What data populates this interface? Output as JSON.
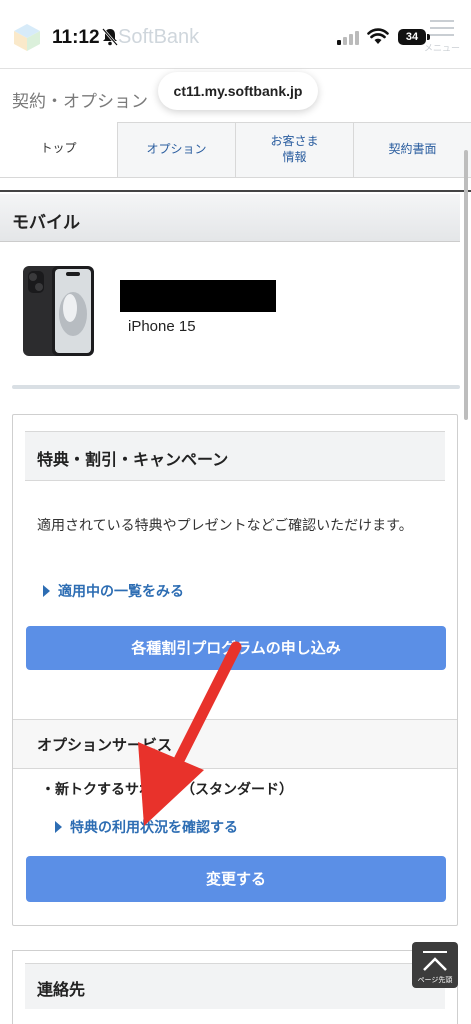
{
  "status_bar": {
    "time": "11:12",
    "battery": "34",
    "brand_ghost": "SoftBank",
    "menu_ghost": "メニュー"
  },
  "header": {
    "title": "契約・オプション",
    "url": "ct11.my.softbank.jp"
  },
  "tabs": [
    {
      "label": "トップ"
    },
    {
      "label": "オプション"
    },
    {
      "label": "お客さま\n情報"
    },
    {
      "label": "契約書面"
    }
  ],
  "mobile": {
    "section_title": "モバイル",
    "device_name": "iPhone 15"
  },
  "benefits": {
    "title": "特典・割引・キャンペーン",
    "description": "適用されている特典やプレゼントなどご確認いただけます。",
    "link_label": "適用中の一覧をみる",
    "apply_button": "各種割引プログラムの申し込み"
  },
  "options": {
    "title": "オプションサービス",
    "item": "・新トクするサポート（スタンダード）",
    "link_label": "特典の利用状況を確認する",
    "change_button": "変更する"
  },
  "contact": {
    "title": "連絡先"
  },
  "page_top": {
    "label": "ページ先頭"
  },
  "colors": {
    "accent_button": "#5b8fe6",
    "link": "#2d6db3",
    "annotation_arrow": "#e8322b"
  }
}
